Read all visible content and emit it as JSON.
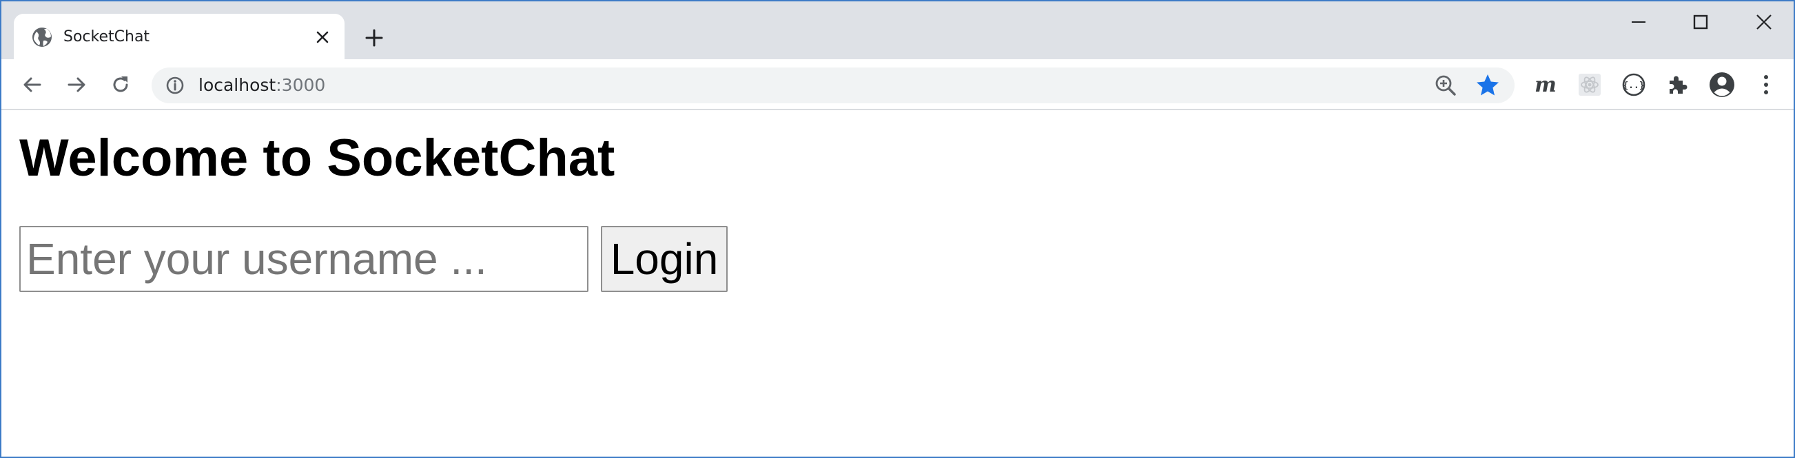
{
  "browser": {
    "tab": {
      "title": "SocketChat",
      "favicon": "globe-icon"
    },
    "address_bar": {
      "host": "localhost",
      "port": ":3000"
    },
    "colors": {
      "accent": "#1a73e8",
      "tabstrip": "#dee1e6",
      "window_border": "#3d7bc7"
    }
  },
  "page": {
    "title": "Welcome to SocketChat",
    "login_form": {
      "username_placeholder": "Enter your username ...",
      "username_value": "",
      "login_label": "Login"
    }
  }
}
